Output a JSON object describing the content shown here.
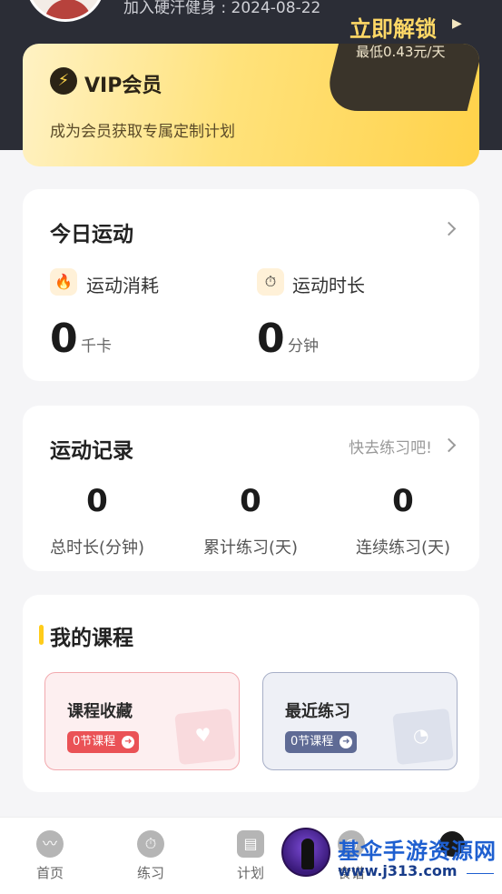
{
  "profile": {
    "join_date": "加入硬汗健身 : 2024-08-22"
  },
  "vip": {
    "logo_glyph": "⚡",
    "title": "VIP会员",
    "description": "成为会员获取专属定制计划",
    "unlock_label": "立即解锁",
    "unlock_arrow": "▶",
    "price_text": "最低0.43元/天"
  },
  "today": {
    "title": "今日运动",
    "calories": {
      "icon": "flame-icon",
      "glyph": "🔥",
      "label": "运动消耗",
      "value": "0",
      "unit": "千卡"
    },
    "duration": {
      "icon": "stopwatch-icon",
      "glyph": "⏱",
      "label": "运动时长",
      "value": "0",
      "unit": "分钟"
    }
  },
  "records": {
    "title": "运动记录",
    "hint": "快去练习吧!",
    "stats": [
      {
        "value": "0",
        "label": "总时长(分钟)"
      },
      {
        "value": "0",
        "label": "累计练习(天)"
      },
      {
        "value": "0",
        "label": "连续练习(天)"
      }
    ]
  },
  "courses": {
    "title": "我的课程",
    "favorites": {
      "title": "课程收藏",
      "badge": "0节课程",
      "deco_glyph": "♥"
    },
    "recent": {
      "title": "最近练习",
      "badge": "0节课程",
      "deco_glyph": "◔"
    }
  },
  "tabbar": {
    "tabs": [
      {
        "label": "首页",
        "icon": "pulse-icon",
        "glyph": "〰"
      },
      {
        "label": "练习",
        "icon": "stopwatch-icon",
        "glyph": "⏱"
      },
      {
        "label": "计划",
        "icon": "calendar-icon",
        "glyph": "▤"
      },
      {
        "label": "食谱",
        "icon": "food-icon",
        "glyph": "◉"
      }
    ]
  },
  "watermark": {
    "title": "基伞手游资源网",
    "url": "www.j313.com"
  },
  "colors": {
    "header_bg": "#2b2d36",
    "vip_gold": "#ffd24a",
    "accent_yellow": "#ffcc1a",
    "fav_red": "#ea5256",
    "recent_blue": "#5f6b95"
  }
}
